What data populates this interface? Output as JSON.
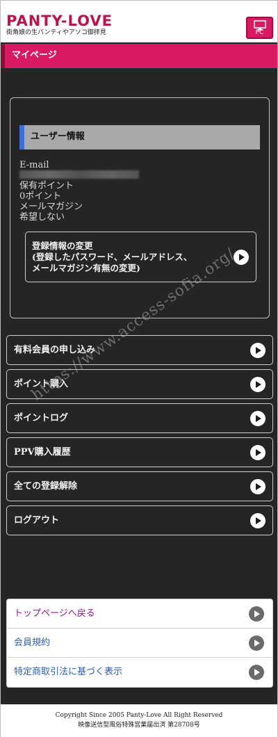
{
  "header": {
    "logo_title": "PANTY-LOVE",
    "logo_subtitle": "街角娘の生パンティやアソコ御拝見",
    "pc_button_label": "PC",
    "pc_icon": "monitor-icon"
  },
  "page_title": "マイページ",
  "user_info": {
    "heading": "ユーザー情報",
    "email_label": "E-mail",
    "points_label": "保有ポイント",
    "points_value": "0ポイント",
    "newsletter_label": "メールマガジン",
    "newsletter_value": "希望しない",
    "edit_button": {
      "line1": "登録情報の変更",
      "line2": "(登録したパスワード、メールアドレス、",
      "line3": "メールマガジン有無の変更)"
    }
  },
  "menu": [
    {
      "label": "有料会員の申し込み"
    },
    {
      "label": "ポイント購入"
    },
    {
      "label": "ポイントログ"
    },
    {
      "label": "PPV購入履歴"
    },
    {
      "label": "全ての登録解除"
    },
    {
      "label": "ログアウト"
    }
  ],
  "footer_links": [
    {
      "label": "トップページへ戻る",
      "color": "#8a1a8a"
    },
    {
      "label": "会員規約",
      "color": "#2f5fa8"
    },
    {
      "label": "特定商取引法に基づく表示",
      "color": "#2f5fa8"
    }
  ],
  "copyright": {
    "line1": "Copyright Since 2005 Panty-Love All Right Reserved",
    "line2": "映像送信型風俗特殊営業届出済 第28708号"
  },
  "watermark": "https://www.access-sofia.org/",
  "colors": {
    "accent": "#d91a63",
    "background": "#252525",
    "section_marker": "#3d6fd8"
  }
}
